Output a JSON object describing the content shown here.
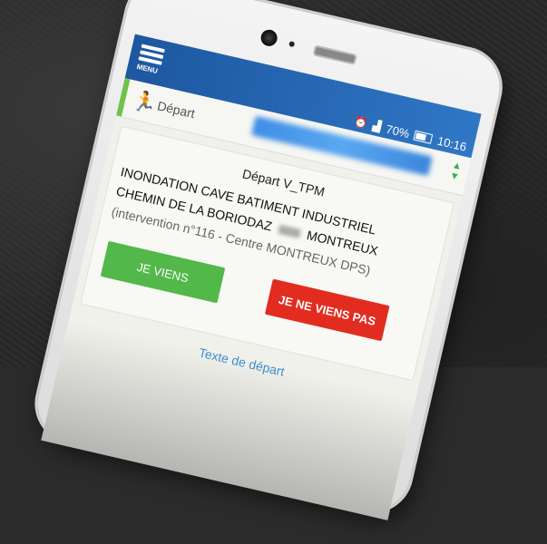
{
  "status_bar": {
    "alarm_icon": "alarm-clock-icon",
    "signal_icon": "signal-4g-icon",
    "battery_percent": "70%",
    "battery_level": 0.7,
    "time": "10:16"
  },
  "app_bar": {
    "menu_label": "MENU",
    "menu_icon": "hamburger-icon",
    "color": "#2f77c6"
  },
  "header": {
    "icon": "running-person-icon",
    "label": "Départ",
    "accent": "#6fc24a"
  },
  "alert": {
    "title": "Départ V_TPM",
    "line1": "INONDATION CAVE BATIMENT INDUSTRIEL",
    "line2_part1": "CHEMIN DE LA BORIODAZ",
    "line2_part2": "MONTREUX",
    "line3": "(intervention n°116 - Centre MONTREUX DPS)"
  },
  "actions": {
    "accept_label": "JE VIENS",
    "accept_color": "#52b84a",
    "decline_label": "JE NE VIENS PAS",
    "decline_color": "#e22c20"
  },
  "footer": {
    "link_label": "Texte de départ",
    "link_color": "#3f8fd0"
  }
}
